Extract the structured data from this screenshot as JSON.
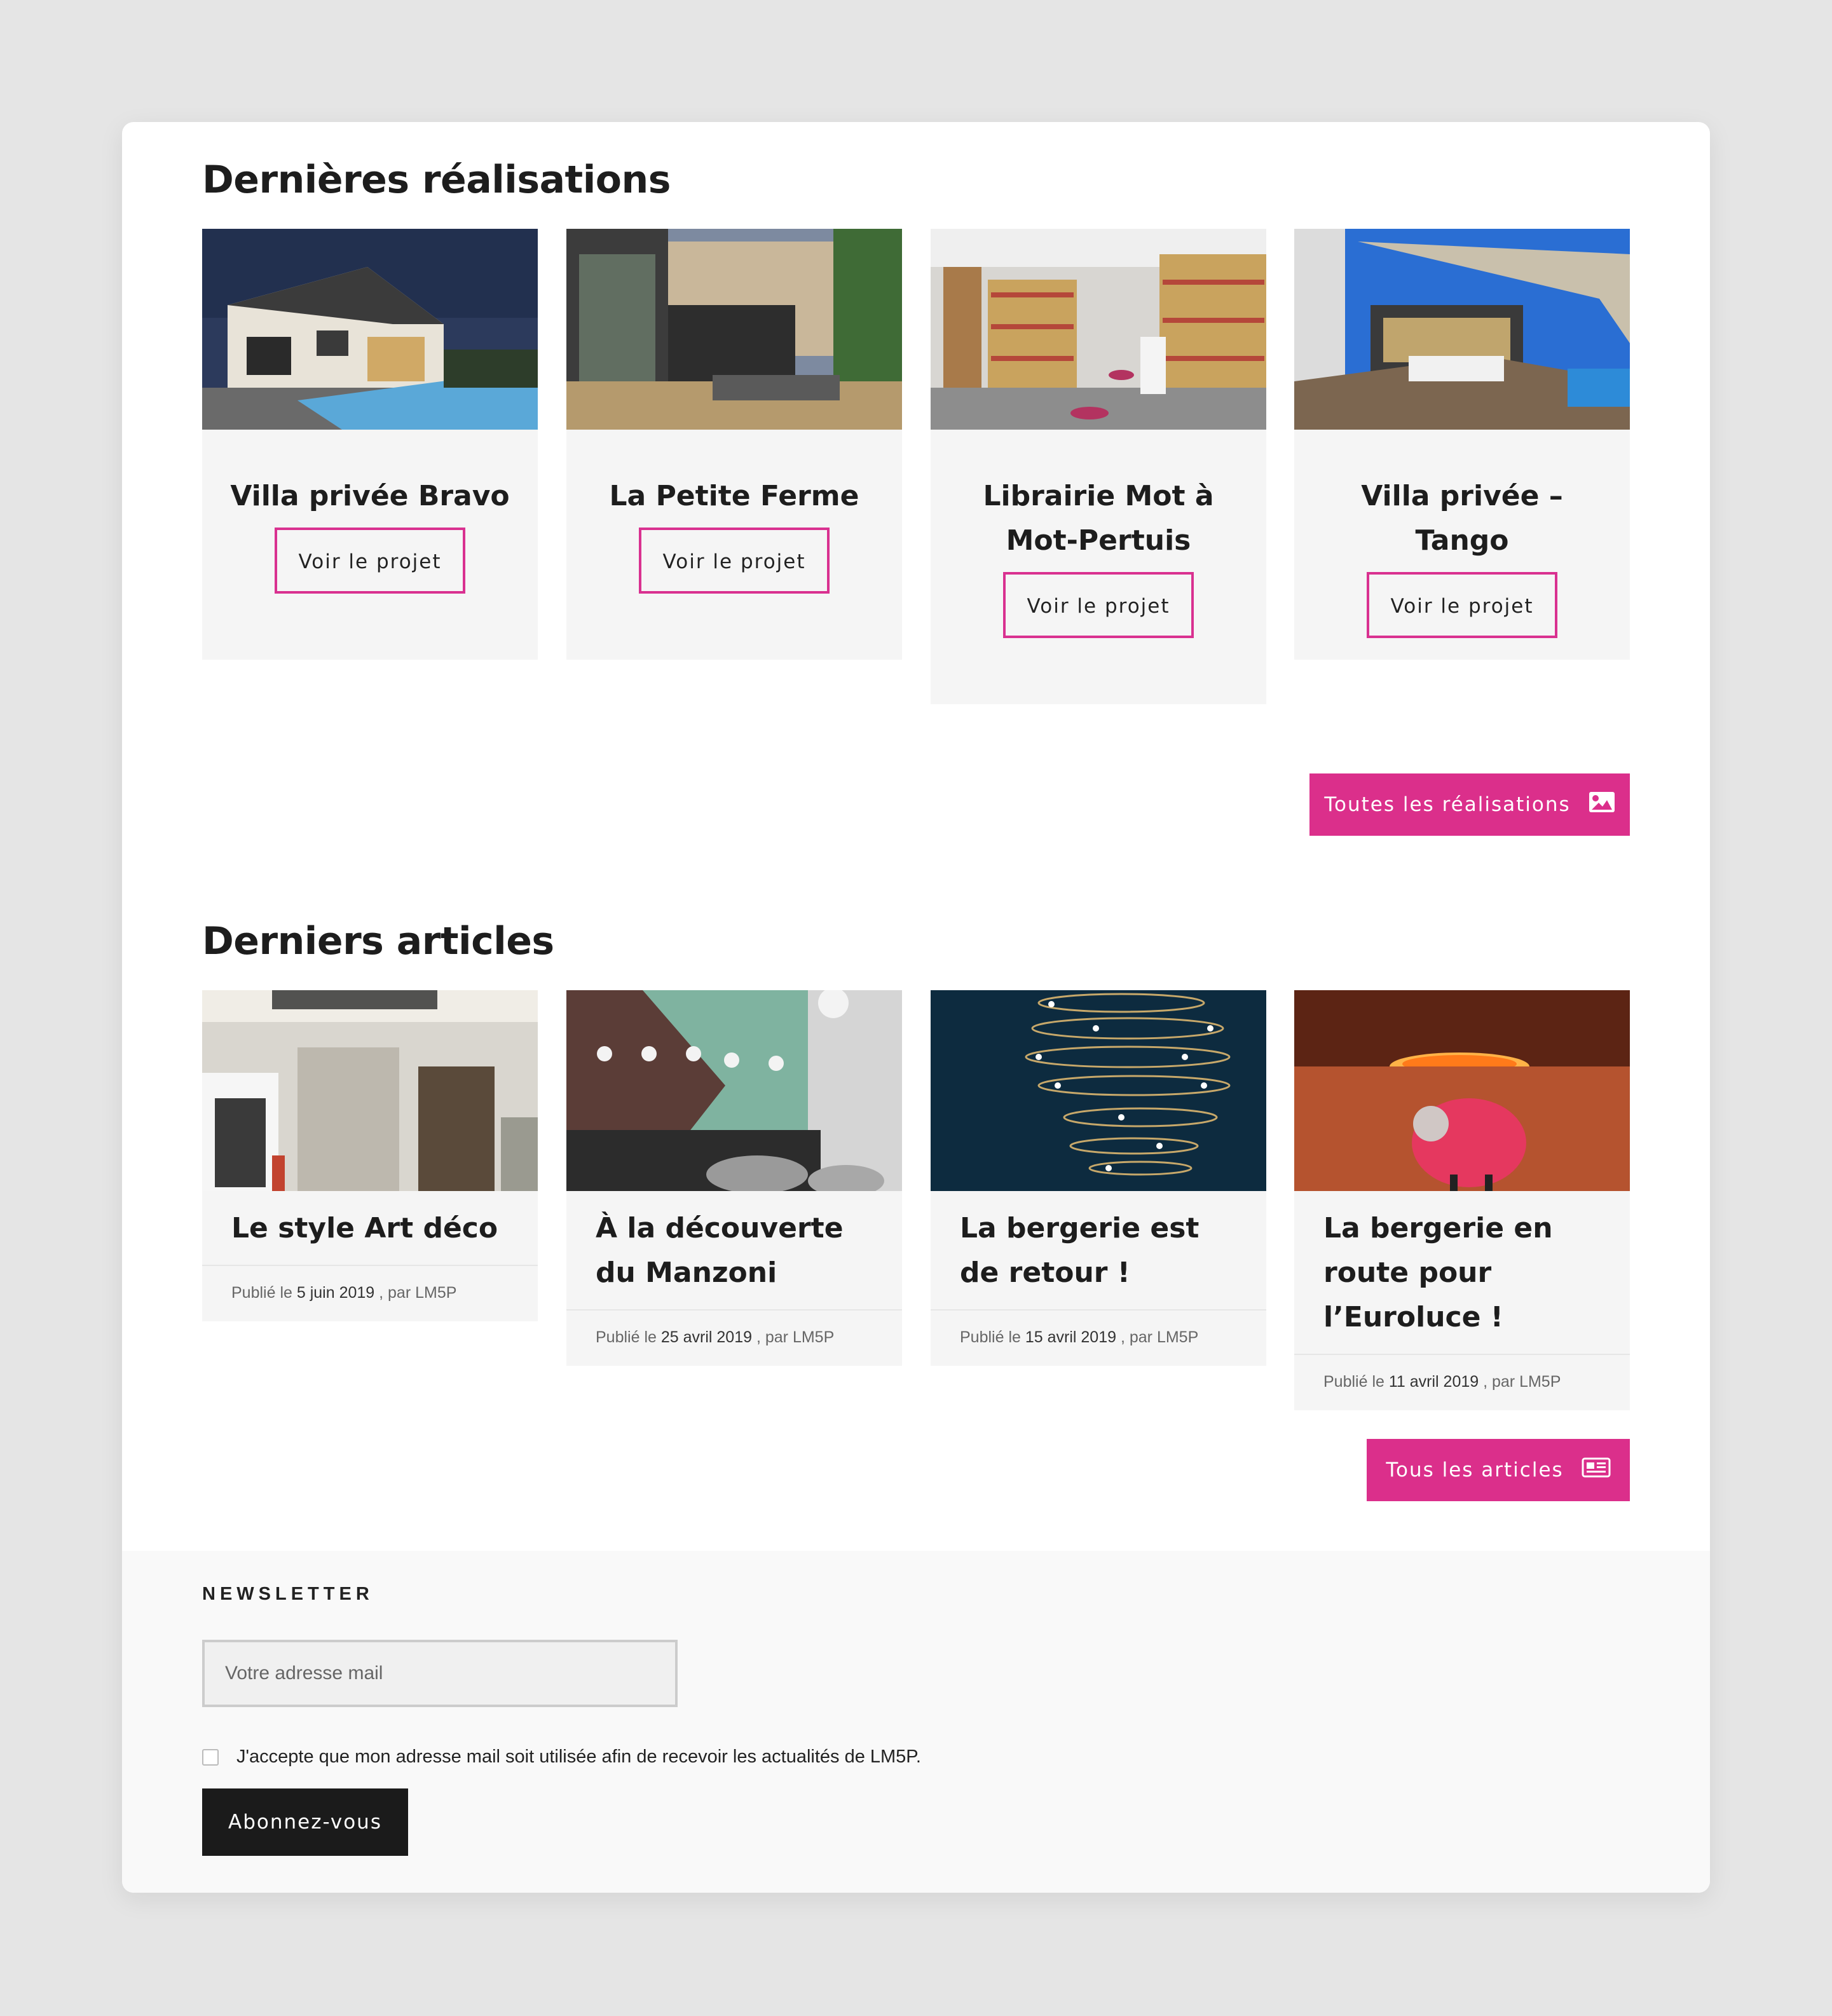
{
  "realisations": {
    "title": "Dernières réalisations",
    "cards": [
      {
        "title": "Villa privée Bravo",
        "button": "Voir le projet"
      },
      {
        "title": "La Petite Ferme",
        "button": "Voir le projet"
      },
      {
        "title": "Librairie Mot à Mot-Pertuis",
        "button": "Voir le projet"
      },
      {
        "title": "Villa privée – Tango",
        "button": "Voir le projet"
      }
    ],
    "all_button": "Toutes les réalisations",
    "all_icon": "image-icon"
  },
  "articles": {
    "title": "Derniers articles",
    "meta_prefix": "Publié le",
    "meta_suffix": ", par LM5P",
    "cards": [
      {
        "title": "Le style Art déco",
        "date": "5 juin 2019"
      },
      {
        "title": "À la découverte du Manzoni",
        "date": "25 avril 2019"
      },
      {
        "title": "La bergerie est de retour !",
        "date": "15 avril 2019"
      },
      {
        "title": "La bergerie en route pour l’Euroluce !",
        "date": "11 avril 2019"
      }
    ],
    "all_button": "Tous les articles",
    "all_icon": "newspaper-icon"
  },
  "newsletter": {
    "label": "NEWSLETTER",
    "placeholder": "Votre adresse mail",
    "consent": "J'accepte que mon adresse mail soit utilisée afin de recevoir les actualités de LM5P.",
    "button": "Abonnez-vous"
  },
  "colors": {
    "accent": "#db2f8b",
    "dark_button": "#1b1b1b",
    "card_bg": "#f5f5f5"
  }
}
